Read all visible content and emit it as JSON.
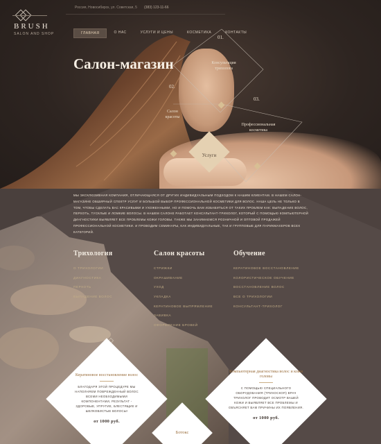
{
  "header": {
    "logo": "BRUSH",
    "logo_sub": "SALON AND SHOP",
    "address": "Россия, Новосибирск, ул. Советская, 5",
    "phone": "(383) 123-11-66"
  },
  "nav": [
    "Главная",
    "О нас",
    "Услуги и цены",
    "Косметика",
    "Контакты"
  ],
  "hero": {
    "title": "Салон-магазин",
    "items": [
      {
        "num": "01.",
        "label": "Консультация трихолога"
      },
      {
        "num": "02.",
        "label": "Салон красоты"
      },
      {
        "num": "03.",
        "label": "Профессиональная косметика"
      }
    ],
    "services_label": "Услуги"
  },
  "intro": "Мы эксклюзивная компания, отличающаяся от других индивидуальным подходом к нашим клиентам. В нашем салон-магазине обширный спектр услуг и большой выбор профессиональной косметики для волос. Наша цель не только в том, чтобы сделать вас красивыми и ухоженными, но и помочь вам избавиться от таких проблем как: выпадение волос, перхоть, тусклые и ломкие волосы. В нашем салоне работает консультант-трихолог, который с помощью компьютерной диагностики выявляет все проблемы кожи головы. Также мы занимаемся розничной и оптовой продажей профессиональной косметики. И проводим семинары, как индивидуальные, так и групповые для парикмахеров всех категорий.",
  "columns": [
    {
      "title": "Трихология",
      "items": [
        "О трихологии",
        "Диагностика",
        "Перхоть",
        "Выпадение волос"
      ]
    },
    {
      "title": "Салон красоты",
      "items": [
        "Стрижки",
        "Окрашивание",
        "Уход",
        "Укладка",
        "Кератиновое выпрямление",
        "Завивка",
        "Оформление бровей"
      ]
    },
    {
      "title": "Обучение",
      "items": [
        "Кератиновое восстановление",
        "Колористическое обучение",
        "Восстановление волос",
        "Все о трихологии",
        "Консультант-трихолог"
      ]
    }
  ],
  "cards": [
    {
      "title": "Кератиновое восстановление волос",
      "body": "Благодаря этой процедуре мы наполняем поврежденный волос всеми необходимыми компонентами, результат - здоровые, упругие, блестящие и шелковистые волосы!",
      "price": "от 1000 руб."
    },
    {
      "title": "Компьютерная диагностика волос и кожи головы",
      "body": "С помощью специального оборудования (трихоскоп) врач трихолог проводит осмотр вашей кожи и выявляет все проблемы и объясняет вам причины их появления.",
      "price": "от 1000 руб."
    }
  ],
  "small_card": "Ботокс"
}
